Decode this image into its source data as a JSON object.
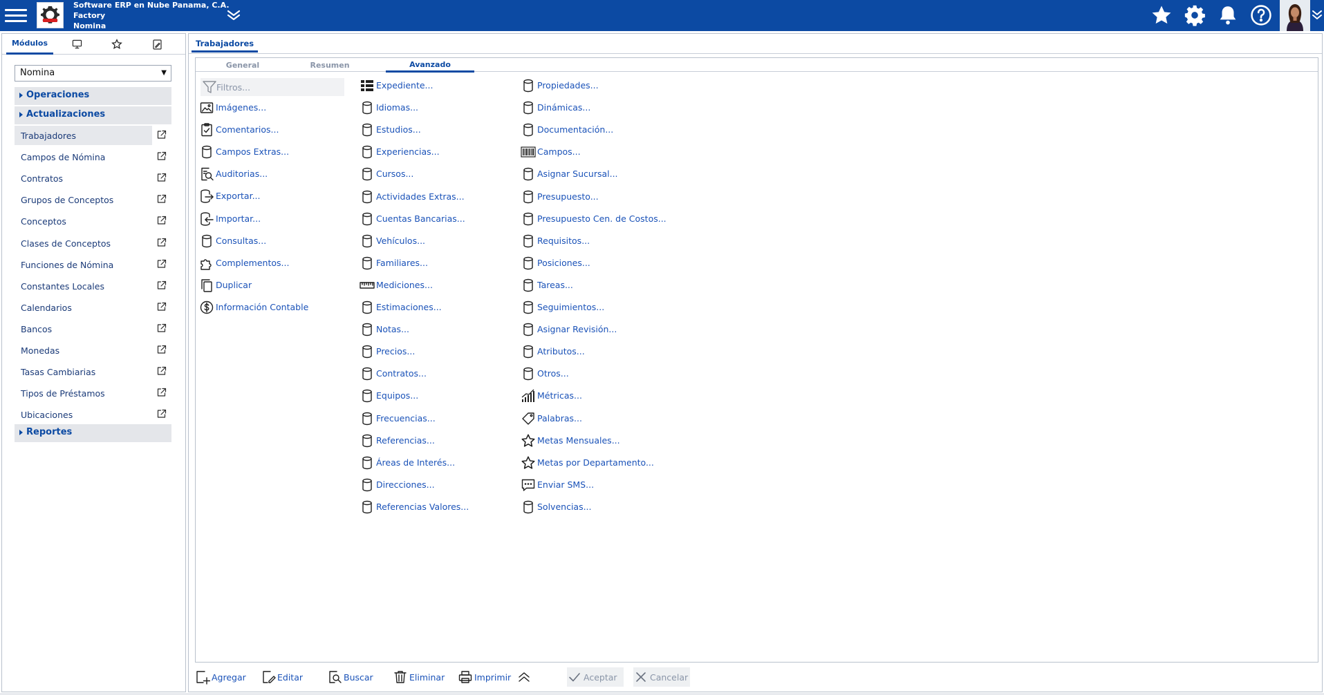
{
  "header": {
    "company": "Software ERP en Nube Panama, C.A.",
    "branch": "Factory",
    "module": "Nomina",
    "icons": [
      "menu-icon",
      "chevrons-down-icon",
      "star-icon",
      "gear-icon",
      "bell-icon",
      "help-icon",
      "user-avatar",
      "chevron-down-icon"
    ]
  },
  "sidebar": {
    "tabs": [
      {
        "label": "Módulos",
        "icon": null
      },
      {
        "label": "",
        "icon": "monitor-icon"
      },
      {
        "label": "",
        "icon": "star-icon"
      },
      {
        "label": "",
        "icon": "edit-icon"
      }
    ],
    "module_select": "Nomina",
    "sections": [
      "Operaciones",
      "Actualizaciones",
      "Reportes"
    ],
    "items": [
      {
        "label": "Trabajadores"
      },
      {
        "label": "Campos de Nómina"
      },
      {
        "label": "Contratos"
      },
      {
        "label": "Grupos de Conceptos"
      },
      {
        "label": "Conceptos"
      },
      {
        "label": "Clases de Conceptos"
      },
      {
        "label": "Funciones de Nómina"
      },
      {
        "label": "Constantes Locales"
      },
      {
        "label": "Calendarios"
      },
      {
        "label": "Bancos"
      },
      {
        "label": "Monedas"
      },
      {
        "label": "Tasas Cambiarias"
      },
      {
        "label": "Tipos de Préstamos"
      },
      {
        "label": "Ubicaciones"
      }
    ]
  },
  "main": {
    "tab": "Trabajadores",
    "subtabs": [
      "General",
      "Resumen",
      "Avanzado"
    ],
    "active_subtab": "Avanzado",
    "filter_placeholder": "Filtros...",
    "col1": [
      {
        "label": "Imágenes...",
        "icon": "image-icon"
      },
      {
        "label": "Comentarios...",
        "icon": "clipboard-icon"
      },
      {
        "label": "Campos Extras...",
        "icon": "database-icon"
      },
      {
        "label": "Auditorias...",
        "icon": "audit-search-icon"
      },
      {
        "label": "Exportar...",
        "icon": "export-icon"
      },
      {
        "label": "Importar...",
        "icon": "import-icon"
      },
      {
        "label": "Consultas...",
        "icon": "database-icon"
      },
      {
        "label": "Complementos...",
        "icon": "puzzle-icon"
      },
      {
        "label": "Duplicar",
        "icon": "copy-icon"
      },
      {
        "label": "Información Contable",
        "icon": "dollar-icon"
      }
    ],
    "col2": [
      {
        "label": "Expediente...",
        "icon": "grid-list-icon"
      },
      {
        "label": "Idiomas...",
        "icon": "database-icon"
      },
      {
        "label": "Estudios...",
        "icon": "database-icon"
      },
      {
        "label": "Experiencias...",
        "icon": "database-icon"
      },
      {
        "label": "Cursos...",
        "icon": "database-icon"
      },
      {
        "label": "Actividades Extras...",
        "icon": "database-icon"
      },
      {
        "label": "Cuentas Bancarias...",
        "icon": "database-icon"
      },
      {
        "label": "Vehículos...",
        "icon": "database-icon"
      },
      {
        "label": "Familiares...",
        "icon": "database-icon"
      },
      {
        "label": "Mediciones...",
        "icon": "ruler-icon"
      },
      {
        "label": "Estimaciones...",
        "icon": "database-icon"
      },
      {
        "label": "Notas...",
        "icon": "database-icon"
      },
      {
        "label": "Precios...",
        "icon": "database-icon"
      },
      {
        "label": "Contratos...",
        "icon": "database-icon"
      },
      {
        "label": "Equipos...",
        "icon": "database-icon"
      },
      {
        "label": "Frecuencias...",
        "icon": "database-icon"
      },
      {
        "label": "Referencias...",
        "icon": "database-icon"
      },
      {
        "label": "Áreas de Interés...",
        "icon": "database-icon"
      },
      {
        "label": "Direcciones...",
        "icon": "database-icon"
      },
      {
        "label": "Referencias Valores...",
        "icon": "database-icon"
      }
    ],
    "col3": [
      {
        "label": "Propiedades...",
        "icon": "database-icon"
      },
      {
        "label": "Dinámicas...",
        "icon": "database-icon"
      },
      {
        "label": "Documentación...",
        "icon": "database-icon"
      },
      {
        "label": "Campos...",
        "icon": "barcode-icon"
      },
      {
        "label": "Asignar Sucursal...",
        "icon": "database-icon"
      },
      {
        "label": "Presupuesto...",
        "icon": "database-icon"
      },
      {
        "label": "Presupuesto Cen. de Costos...",
        "icon": "database-icon"
      },
      {
        "label": "Requisitos...",
        "icon": "database-icon"
      },
      {
        "label": "Posiciones...",
        "icon": "database-icon"
      },
      {
        "label": "Tareas...",
        "icon": "database-icon"
      },
      {
        "label": "Seguimientos...",
        "icon": "database-icon"
      },
      {
        "label": "Asignar Revisión...",
        "icon": "database-icon"
      },
      {
        "label": "Atributos...",
        "icon": "database-icon"
      },
      {
        "label": "Otros...",
        "icon": "database-icon"
      },
      {
        "label": "Métricas...",
        "icon": "chart-icon"
      },
      {
        "label": "Palabras...",
        "icon": "tag-icon"
      },
      {
        "label": "Metas Mensuales...",
        "icon": "star-icon"
      },
      {
        "label": "Metas por Departamento...",
        "icon": "star-icon"
      },
      {
        "label": "Enviar SMS...",
        "icon": "message-icon"
      },
      {
        "label": "Solvencias...",
        "icon": "database-icon"
      }
    ]
  },
  "footer": {
    "buttons": [
      {
        "label": "Agregar",
        "icon": "add-icon"
      },
      {
        "label": "Editar",
        "icon": "edit-icon"
      },
      {
        "label": "Buscar",
        "icon": "search-icon"
      },
      {
        "label": "Eliminar",
        "icon": "trash-icon"
      },
      {
        "label": "Imprimir",
        "icon": "printer-icon"
      },
      {
        "label": "",
        "icon": "chevrons-up-icon"
      },
      {
        "label": "Aceptar",
        "icon": "check-icon"
      },
      {
        "label": "Cancelar",
        "icon": "close-icon"
      }
    ]
  },
  "colors": {
    "header_bg": "#0c4aa3",
    "link": "#1a52b8",
    "accent": "#0c4aa3",
    "muted": "#8a95a8"
  }
}
